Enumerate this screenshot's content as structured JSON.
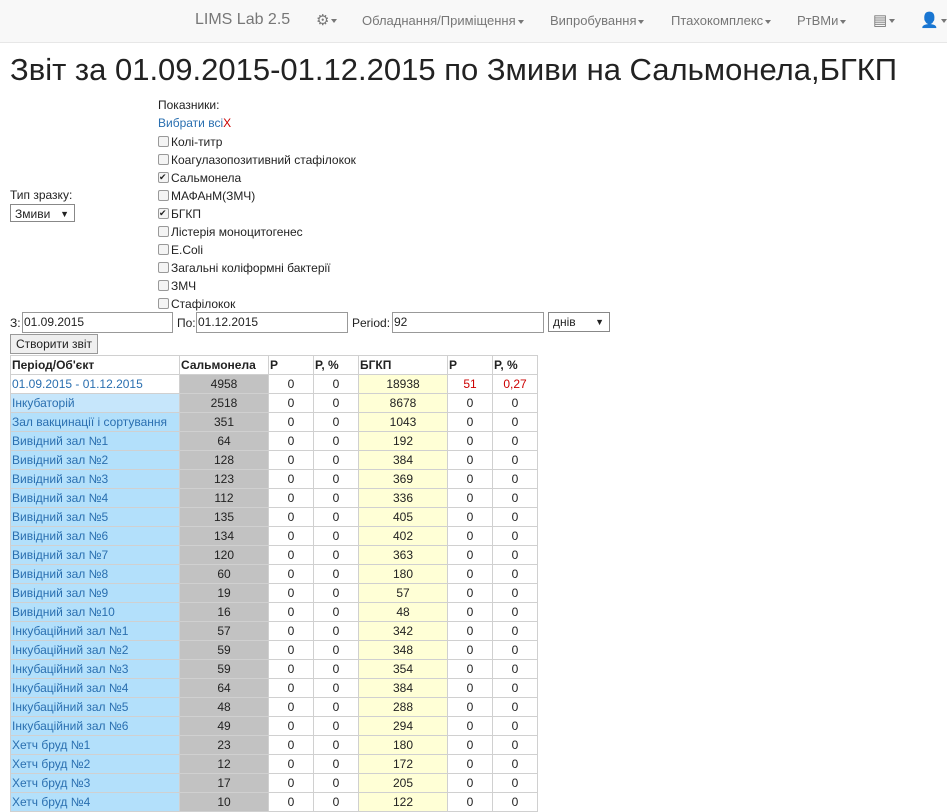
{
  "nav": {
    "brand": "LIMS Lab 2.5",
    "items": [
      "Обладнання/Приміщення",
      "Випробування",
      "Птахокомплекс",
      "РтВМи"
    ]
  },
  "title": "Звіт за 01.09.2015-01.12.2015 по Змиви на Сальмонела,БГКП",
  "filters": {
    "indicators_label": "Показники:",
    "select_all": "Вибрати всі",
    "clear": "X",
    "sample_type_label": "Тип зразку:",
    "sample_type_value": "Змиви",
    "checkboxes": [
      {
        "label": "Колі-титр",
        "checked": false
      },
      {
        "label": "Коагулазопозитивний стафілокок",
        "checked": false
      },
      {
        "label": "Сальмонела",
        "checked": true
      },
      {
        "label": "МАФАнМ(ЗМЧ)",
        "checked": false
      },
      {
        "label": "БГКП",
        "checked": true
      },
      {
        "label": "Лістерія моноцитогенес",
        "checked": false
      },
      {
        "label": "E.Coli",
        "checked": false
      },
      {
        "label": "Загальні коліформні бактерії",
        "checked": false
      },
      {
        "label": "ЗМЧ",
        "checked": false
      },
      {
        "label": "Стафілокок",
        "checked": false
      }
    ],
    "from_label": "З:",
    "from_value": "01.09.2015",
    "to_label": "По:",
    "to_value": "01.12.2015",
    "period_label": "Period:",
    "period_value": "92",
    "unit_value": "днів",
    "create_button": "Створити звіт"
  },
  "table": {
    "headers": [
      "Період/Об'єкт",
      "Сальмонела",
      "Р",
      "Р, %",
      "БГКП",
      "Р",
      "Р, %"
    ],
    "rows": [
      [
        "01.09.2015 - 01.12.2015",
        "4958",
        "0",
        "0",
        "18938",
        "51",
        "0,27"
      ],
      [
        "Інкубаторій",
        "2518",
        "0",
        "0",
        "8678",
        "0",
        "0"
      ],
      [
        "Зал вакцинації і сортування",
        "351",
        "0",
        "0",
        "1043",
        "0",
        "0"
      ],
      [
        "Вивідний зал №1",
        "64",
        "0",
        "0",
        "192",
        "0",
        "0"
      ],
      [
        "Вивідний зал №2",
        "128",
        "0",
        "0",
        "384",
        "0",
        "0"
      ],
      [
        "Вивідний зал №3",
        "123",
        "0",
        "0",
        "369",
        "0",
        "0"
      ],
      [
        "Вивідний зал №4",
        "112",
        "0",
        "0",
        "336",
        "0",
        "0"
      ],
      [
        "Вивідний зал №5",
        "135",
        "0",
        "0",
        "405",
        "0",
        "0"
      ],
      [
        "Вивідний зал №6",
        "134",
        "0",
        "0",
        "402",
        "0",
        "0"
      ],
      [
        "Вивідний зал №7",
        "120",
        "0",
        "0",
        "363",
        "0",
        "0"
      ],
      [
        "Вивідний зал №8",
        "60",
        "0",
        "0",
        "180",
        "0",
        "0"
      ],
      [
        "Вивідний зал №9",
        "19",
        "0",
        "0",
        "57",
        "0",
        "0"
      ],
      [
        "Вивідний зал №10",
        "16",
        "0",
        "0",
        "48",
        "0",
        "0"
      ],
      [
        "Інкубаційний зал №1",
        "57",
        "0",
        "0",
        "342",
        "0",
        "0"
      ],
      [
        "Інкубаційний зал №2",
        "59",
        "0",
        "0",
        "348",
        "0",
        "0"
      ],
      [
        "Інкубаційний зал №3",
        "59",
        "0",
        "0",
        "354",
        "0",
        "0"
      ],
      [
        "Інкубаційний зал №4",
        "64",
        "0",
        "0",
        "384",
        "0",
        "0"
      ],
      [
        "Інкубаційний зал №5",
        "48",
        "0",
        "0",
        "288",
        "0",
        "0"
      ],
      [
        "Інкубаційний зал №6",
        "49",
        "0",
        "0",
        "294",
        "0",
        "0"
      ],
      [
        "Хетч бруд №1",
        "23",
        "0",
        "0",
        "180",
        "0",
        "0"
      ],
      [
        "Хетч бруд №2",
        "12",
        "0",
        "0",
        "172",
        "0",
        "0"
      ],
      [
        "Хетч бруд №3",
        "17",
        "0",
        "0",
        "205",
        "0",
        "0"
      ],
      [
        "Хетч бруд №4",
        "10",
        "0",
        "0",
        "122",
        "0",
        "0"
      ]
    ]
  }
}
